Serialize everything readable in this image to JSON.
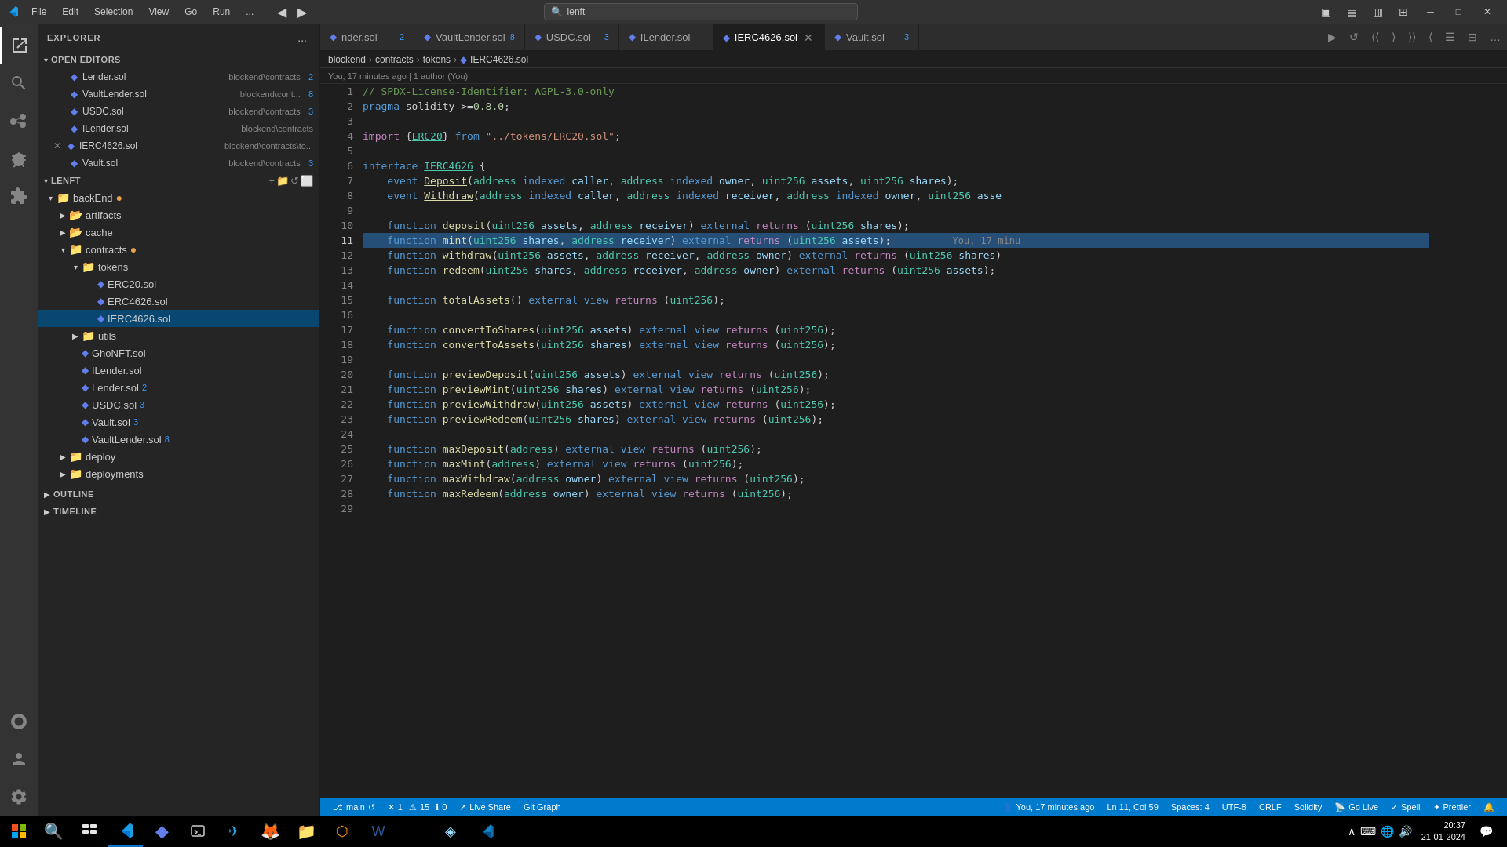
{
  "titlebar": {
    "app_icon": "VS",
    "menu_items": [
      "File",
      "Edit",
      "Selection",
      "View",
      "Go",
      "Run",
      "..."
    ],
    "search_placeholder": "lenft",
    "search_value": "lenft",
    "layout_btns": [
      "▣",
      "▤",
      "▥",
      "⊞"
    ],
    "win_btns": [
      "─",
      "□",
      "✕"
    ]
  },
  "sidebar": {
    "title": "EXPLORER",
    "more_btn": "...",
    "open_editors": {
      "label": "OPEN EDITORS",
      "items": [
        {
          "name": "Lender.sol",
          "path": "blockend\\contracts",
          "badge": "2",
          "icon": "◆",
          "color": "#627eea"
        },
        {
          "name": "VaultLender.sol",
          "path": "blockend\\cont...",
          "badge": "8",
          "icon": "◆",
          "color": "#627eea"
        },
        {
          "name": "USDC.sol",
          "path": "blockend\\contracts",
          "badge": "3",
          "icon": "◆",
          "color": "#627eea"
        },
        {
          "name": "ILender.sol",
          "path": "blockend\\contracts",
          "badge": "",
          "icon": "◆",
          "color": "#627eea"
        },
        {
          "name": "IERC4626.sol",
          "path": "blockend\\contracts\\to...",
          "badge": "",
          "icon": "◆",
          "color": "#627eea",
          "dirty": true
        },
        {
          "name": "Vault.sol",
          "path": "blockend\\contracts",
          "badge": "3",
          "icon": "◆",
          "color": "#627eea"
        }
      ]
    },
    "explorer": {
      "root_label": "LENFT",
      "tree": [
        {
          "label": "backEnd",
          "type": "folder",
          "expanded": true,
          "depth": 0,
          "dirty": true
        },
        {
          "label": "artifacts",
          "type": "folder-cache",
          "expanded": false,
          "depth": 1
        },
        {
          "label": "cache",
          "type": "folder-cache",
          "expanded": false,
          "depth": 1
        },
        {
          "label": "contracts",
          "type": "folder",
          "expanded": true,
          "depth": 1,
          "dirty": true
        },
        {
          "label": "tokens",
          "type": "folder",
          "expanded": true,
          "depth": 2
        },
        {
          "label": "ERC20.sol",
          "type": "file-sol",
          "depth": 3
        },
        {
          "label": "ERC4626.sol",
          "type": "file-sol",
          "depth": 3
        },
        {
          "label": "IERC4626.sol",
          "type": "file-sol",
          "depth": 3,
          "selected": true
        },
        {
          "label": "utils",
          "type": "folder",
          "expanded": false,
          "depth": 2
        },
        {
          "label": "GhoNFT.sol",
          "type": "file-sol",
          "depth": 2
        },
        {
          "label": "ILender.sol",
          "type": "file-sol",
          "depth": 2
        },
        {
          "label": "Lender.sol",
          "type": "file-sol",
          "depth": 2,
          "badge": "2"
        },
        {
          "label": "USDC.sol",
          "type": "file-sol",
          "depth": 2,
          "badge": "3"
        },
        {
          "label": "Vault.sol",
          "type": "file-sol",
          "depth": 2,
          "badge": "3"
        },
        {
          "label": "VaultLender.sol",
          "type": "file-sol",
          "depth": 2,
          "badge": "8"
        },
        {
          "label": "deploy",
          "type": "folder",
          "expanded": false,
          "depth": 1
        },
        {
          "label": "deployments",
          "type": "folder",
          "expanded": false,
          "depth": 1
        }
      ]
    },
    "outline_label": "OUTLINE",
    "timeline_label": "TIMELINE"
  },
  "tabs": [
    {
      "name": "nder.sol",
      "full": "Lender.sol",
      "badge": "2",
      "active": false,
      "icon": "◆"
    },
    {
      "name": "VaultLender.sol",
      "badge": "8",
      "active": false,
      "icon": "◆"
    },
    {
      "name": "USDC.sol",
      "badge": "3",
      "active": false,
      "icon": "◆"
    },
    {
      "name": "ILender.sol",
      "badge": "",
      "active": false,
      "icon": "◆"
    },
    {
      "name": "IERC4626.sol",
      "badge": "",
      "active": true,
      "icon": "◆",
      "dirty": false
    },
    {
      "name": "Vault.sol",
      "badge": "3",
      "active": false,
      "icon": "◆"
    }
  ],
  "breadcrumb": {
    "items": [
      "blockend",
      "contracts",
      "tokens",
      "IERC4626.sol"
    ]
  },
  "blame": {
    "text": "You, 17 minutes ago | 1 author (You)"
  },
  "code": {
    "lines": [
      {
        "num": 1,
        "text": "// SPDX-License-Identifier: AGPL-3.0-only",
        "type": "comment"
      },
      {
        "num": 2,
        "text": "pragma solidity >=0.8.0;",
        "type": "pragma"
      },
      {
        "num": 3,
        "text": "",
        "type": "empty"
      },
      {
        "num": 4,
        "text": "import {ERC20} from \"../tokens/ERC20.sol\";",
        "type": "import"
      },
      {
        "num": 5,
        "text": "",
        "type": "empty"
      },
      {
        "num": 6,
        "text": "interface IERC4626 {",
        "type": "interface"
      },
      {
        "num": 7,
        "text": "    event Deposit(address indexed caller, address indexed owner, uint256 assets, uint256 shares);",
        "type": "event"
      },
      {
        "num": 8,
        "text": "    event Withdraw(address indexed caller, address indexed receiver, address indexed owner, uint256 asse",
        "type": "event"
      },
      {
        "num": 9,
        "text": "",
        "type": "empty"
      },
      {
        "num": 10,
        "text": "    function deposit(uint256 assets, address receiver) external returns (uint256 shares);",
        "type": "function"
      },
      {
        "num": 11,
        "text": "    function mint(uint256 shares, address receiver) external returns (uint256 assets);",
        "type": "function",
        "highlighted": true,
        "blame": "You, 17 minu"
      },
      {
        "num": 12,
        "text": "    function withdraw(uint256 assets, address receiver, address owner) external returns (uint256 shares)",
        "type": "function"
      },
      {
        "num": 13,
        "text": "    function redeem(uint256 shares, address receiver, address owner) external returns (uint256 assets);",
        "type": "function"
      },
      {
        "num": 14,
        "text": "",
        "type": "empty"
      },
      {
        "num": 15,
        "text": "    function totalAssets() external view returns (uint256);",
        "type": "function"
      },
      {
        "num": 16,
        "text": "",
        "type": "empty"
      },
      {
        "num": 17,
        "text": "    function convertToShares(uint256 assets) external view returns (uint256);",
        "type": "function"
      },
      {
        "num": 18,
        "text": "    function convertToAssets(uint256 shares) external view returns (uint256);",
        "type": "function"
      },
      {
        "num": 19,
        "text": "",
        "type": "empty"
      },
      {
        "num": 20,
        "text": "    function previewDeposit(uint256 assets) external view returns (uint256);",
        "type": "function"
      },
      {
        "num": 21,
        "text": "    function previewMint(uint256 shares) external view returns (uint256);",
        "type": "function"
      },
      {
        "num": 22,
        "text": "    function previewWithdraw(uint256 assets) external view returns (uint256);",
        "type": "function"
      },
      {
        "num": 23,
        "text": "    function previewRedeem(uint256 shares) external view returns (uint256);",
        "type": "function"
      },
      {
        "num": 24,
        "text": "",
        "type": "empty"
      },
      {
        "num": 25,
        "text": "    function maxDeposit(address) external view returns (uint256);",
        "type": "function"
      },
      {
        "num": 26,
        "text": "    function maxMint(address) external view returns (uint256);",
        "type": "function"
      },
      {
        "num": 27,
        "text": "    function maxWithdraw(address owner) external view returns (uint256);",
        "type": "function"
      },
      {
        "num": 28,
        "text": "    function maxRedeem(address owner) external view returns (uint256);",
        "type": "function"
      },
      {
        "num": 29,
        "text": "",
        "type": "empty"
      }
    ]
  },
  "statusbar": {
    "git_branch": "main",
    "errors": "1",
    "warnings": "15",
    "info": "0",
    "blame_status": "You, 17 minutes ago",
    "cursor": "Ln 11, Col 59",
    "spaces": "Spaces: 4",
    "encoding": "UTF-8",
    "line_ending": "CRLF",
    "language": "Solidity",
    "go_live": "Go Live",
    "spell": "Spell",
    "prettier": "Prettier",
    "live_share": "Live Share",
    "git_graph": "Git Graph"
  },
  "taskbar": {
    "time": "20:37",
    "date": "21-01-2024"
  }
}
